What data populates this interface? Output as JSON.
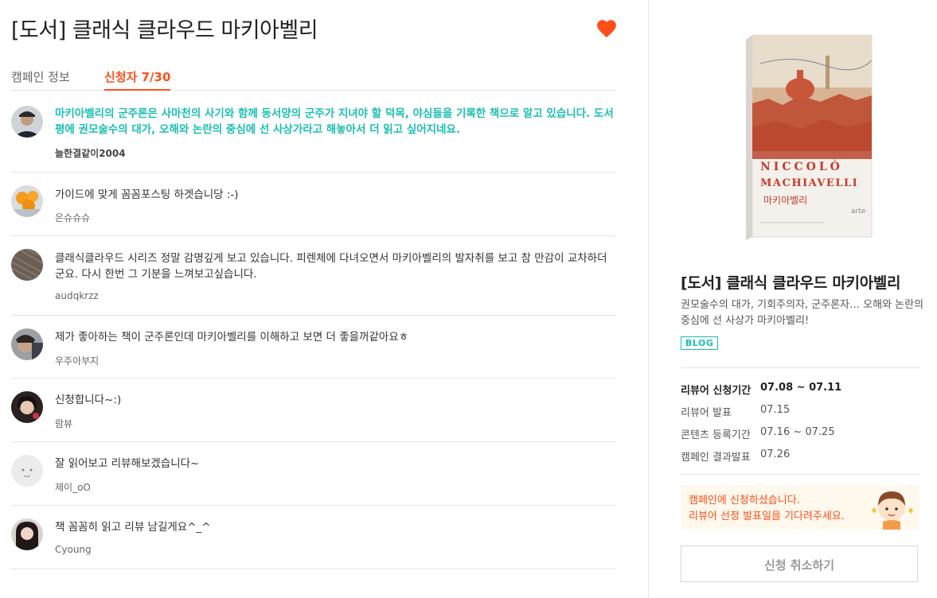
{
  "campaign": {
    "title": "[도서] 클래식 클라우드 마키아벨리",
    "tabs": [
      {
        "label": "캠페인 정보"
      },
      {
        "label": "신청자 7/30"
      }
    ]
  },
  "comments": [
    {
      "text": "마키아벨리의 군주론은 사마천의 사기와 함께 동서양의 군주가 지녀야 할 덕목, 야심들을 기록한 책으로 알고 있습니다. 도서평에 권모술수의 대가, 오해와 논란의 중심에 선 사상가라고 해놓아서 더 읽고 싶어지네요.",
      "user": "늘한결같이2004"
    },
    {
      "text": "가이드에 맞게 꼼꼼포스팅 하겟습니당 :-)",
      "user": "은슈슈슈"
    },
    {
      "text": "클래식클라우드 시리즈 정말 감명깊게 보고 있습니다. 피렌체에 다녀오면서 마키아벨리의 발자취를 보고 참 만감이 교차하더군요. 다시 한번 그 기분을 느껴보고싶습니다.",
      "user": "audqkrzz"
    },
    {
      "text": "제가 좋아하는 책이 군주론인데 마키아벨리를 이해하고 보면 더 좋을꺼같아요ㅎ",
      "user": "우주아부지"
    },
    {
      "text": "신청합니다~:)",
      "user": "람뷰"
    },
    {
      "text": "잘 읽어보고 리뷰해보겠습니다~",
      "user": "제이_oO"
    },
    {
      "text": "책 꼼꼼히 읽고 리뷰 남길게요^_^",
      "user": "Cyoung"
    }
  ],
  "product": {
    "cover": {
      "title_line1": "NICCOLÒ",
      "title_line2": "MACHIAVELLI",
      "korean_title": "마키아벨리",
      "publisher": "arte"
    },
    "title": "[도서] 클래식 클라우드 마키아벨리",
    "description": "권모술수의 대가, 기회주의자, 군주론자… 오해와 논란의 중심에 선 사상가 마키아벨리!",
    "badge": "BLOG"
  },
  "schedule": [
    {
      "label": "리뷰어 신청기간",
      "value": "07.08 ~ 07.11"
    },
    {
      "label": "리뷰어 발표",
      "value": "07.15"
    },
    {
      "label": "콘텐츠 등록기간",
      "value": "07.16 ~ 07.25"
    },
    {
      "label": "캠페인 결과발표",
      "value": "07.26"
    }
  ],
  "notice": {
    "line1": "캠페인에 신청하셨습니다.",
    "line2": "리뷰어 선정 발표일을 기다려주세요."
  },
  "cancel_label": "신청 취소하기",
  "colors": {
    "accent": "#ff4e1a",
    "teal": "#1bbfb1",
    "notice_bg": "#fff8ec"
  }
}
